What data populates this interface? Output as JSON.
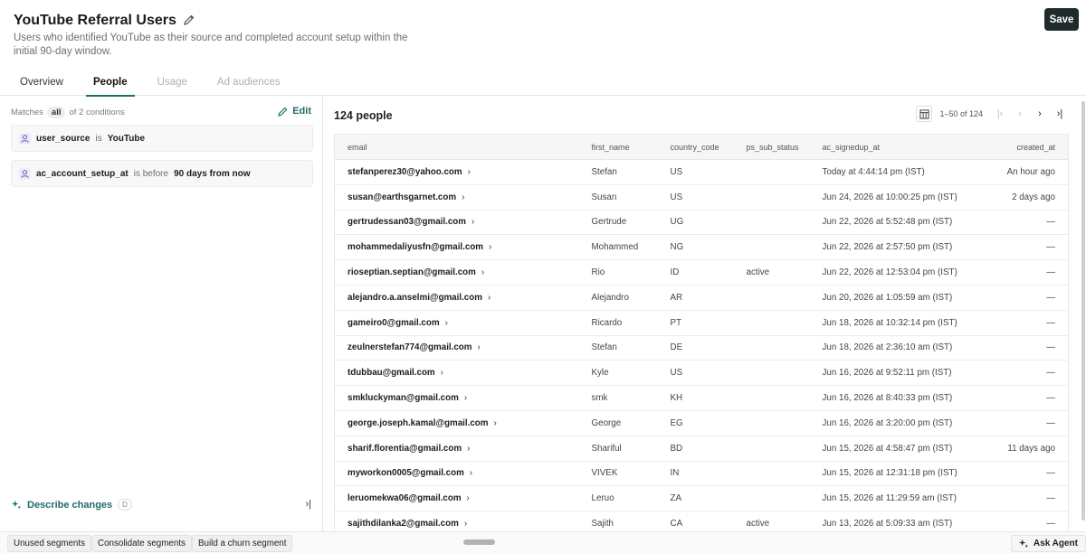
{
  "header": {
    "title": "YouTube Referral Users",
    "description": "Users who identified YouTube as their source and completed account setup within the initial 90-day window.",
    "save_label": "Save"
  },
  "tabs": [
    {
      "label": "Overview",
      "state": "normal"
    },
    {
      "label": "People",
      "state": "active"
    },
    {
      "label": "Usage",
      "state": "disabled"
    },
    {
      "label": "Ad audiences",
      "state": "disabled"
    }
  ],
  "conditions_panel": {
    "matches_prefix": "Matches",
    "matches_mode": "all",
    "matches_suffix": "of 2 conditions",
    "edit_label": "Edit",
    "conditions": [
      {
        "field": "user_source",
        "operator": "is",
        "value": "YouTube"
      },
      {
        "field": "ac_account_setup_at",
        "operator": "is before",
        "value": "90 days from now"
      }
    ],
    "describe_label": "Describe changes",
    "describe_shortcut": "D"
  },
  "people": {
    "count_label": "124 people",
    "range_label": "1–50 of 124",
    "columns": [
      "email",
      "first_name",
      "country_code",
      "ps_sub_status",
      "ac_signedup_at",
      "created_at"
    ],
    "rows": [
      [
        "stefanperez30@yahoo.com",
        "Stefan",
        "US",
        "",
        "Today at 4:44:14 pm (IST)",
        "An hour ago"
      ],
      [
        "susan@earthsgarnet.com",
        "Susan",
        "US",
        "",
        "Jun 24, 2026 at 10:00:25 pm (IST)",
        "2 days ago"
      ],
      [
        "gertrudessan03@gmail.com",
        "Gertrude",
        "UG",
        "",
        "Jun 22, 2026 at 5:52:48 pm (IST)",
        "—"
      ],
      [
        "mohammedaliyusfn@gmail.com",
        "Mohammed",
        "NG",
        "",
        "Jun 22, 2026 at 2:57:50 pm (IST)",
        "—"
      ],
      [
        "rioseptian.septian@gmail.com",
        "Rio",
        "ID",
        "active",
        "Jun 22, 2026 at 12:53:04 pm (IST)",
        "—"
      ],
      [
        "alejandro.a.anselmi@gmail.com",
        "Alejandro",
        "AR",
        "",
        "Jun 20, 2026 at 1:05:59 am (IST)",
        "—"
      ],
      [
        "gameiro0@gmail.com",
        "Ricardo",
        "PT",
        "",
        "Jun 18, 2026 at 10:32:14 pm (IST)",
        "—"
      ],
      [
        "zeulnerstefan774@gmail.com",
        "Stefan",
        "DE",
        "",
        "Jun 18, 2026 at 2:36:10 am (IST)",
        "—"
      ],
      [
        "tdubbau@gmail.com",
        "Kyle",
        "US",
        "",
        "Jun 16, 2026 at 9:52:11 pm (IST)",
        "—"
      ],
      [
        "smkluckyman@gmail.com",
        "smk",
        "KH",
        "",
        "Jun 16, 2026 at 8:40:33 pm (IST)",
        "—"
      ],
      [
        "george.joseph.kamal@gmail.com",
        "George",
        "EG",
        "",
        "Jun 16, 2026 at 3:20:00 pm (IST)",
        "—"
      ],
      [
        "sharif.florentia@gmail.com",
        "Shariful",
        "BD",
        "",
        "Jun 15, 2026 at 4:58:47 pm (IST)",
        "11 days ago"
      ],
      [
        "myworkon0005@gmail.com",
        "VIVEK",
        "IN",
        "",
        "Jun 15, 2026 at 12:31:18 pm (IST)",
        "—"
      ],
      [
        "leruomekwa06@gmail.com",
        "Leruo",
        "ZA",
        "",
        "Jun 15, 2026 at 11:29:59 am (IST)",
        "—"
      ],
      [
        "sajithdilanka2@gmail.com",
        "Sajith",
        "CA",
        "active",
        "Jun 13, 2026 at 5:09:33 am (IST)",
        "—"
      ]
    ]
  },
  "footer": {
    "suggestions": [
      "Unused segments",
      "Consolidate segments",
      "Build a churn segment"
    ],
    "agent_label": "Ask Agent"
  },
  "colors": {
    "accent": "#1f6b6b",
    "save_button_bg": "#1f2b2b"
  }
}
